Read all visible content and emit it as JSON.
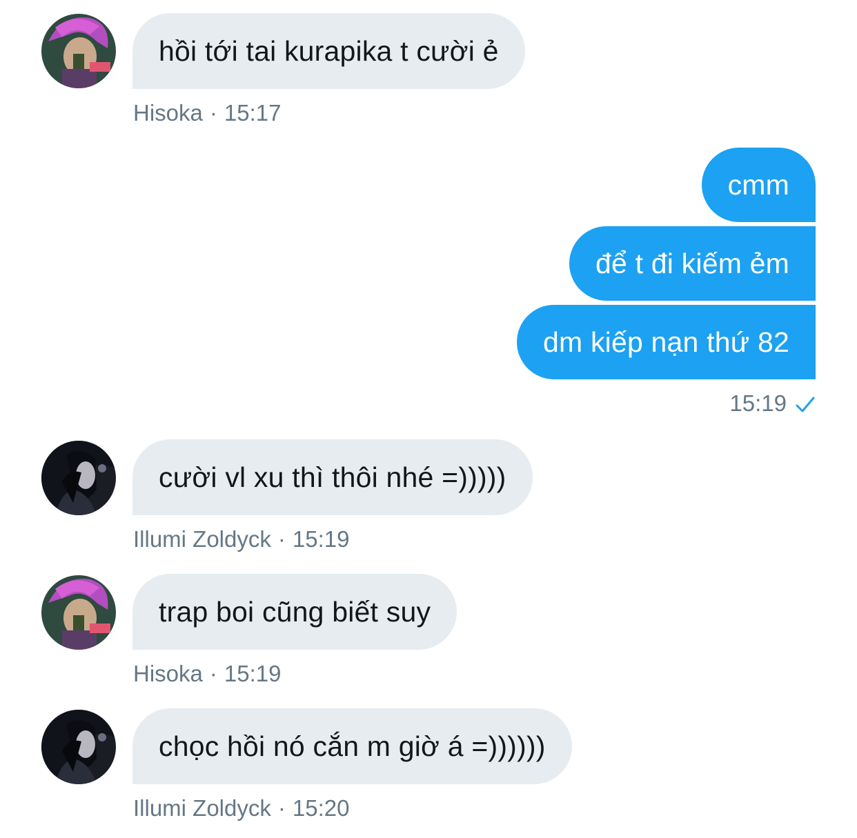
{
  "messages": [
    {
      "sender": "Hisoka",
      "text": "hồi tới tai kurapika t cười ẻ",
      "time": "15:17",
      "avatar_icon": "hisoka-avatar-icon"
    },
    {
      "text": "cmm"
    },
    {
      "text": "để t đi kiếm ẻm"
    },
    {
      "text": "dm kiếp nạn thứ 82",
      "time": "15:19",
      "read_icon": "checkmark-icon"
    },
    {
      "sender": "Illumi Zoldyck",
      "text": "cười vl xu thì thôi nhé =)))))",
      "time": "15:19",
      "avatar_icon": "illumi-avatar-icon"
    },
    {
      "sender": "Hisoka",
      "text": "trap boi cũng biết suy",
      "time": "15:19",
      "avatar_icon": "hisoka-avatar-icon"
    },
    {
      "sender": "Illumi Zoldyck",
      "text": "chọc hồi nó cắn m giờ á =))))))",
      "time": "15:20",
      "avatar_icon": "illumi-avatar-icon"
    }
  ],
  "separator": "·",
  "colors": {
    "incoming_bubble": "#e6ecf0",
    "outgoing_bubble": "#1da1f2",
    "meta_text": "#657786",
    "checkmark": "#1da1f2"
  }
}
